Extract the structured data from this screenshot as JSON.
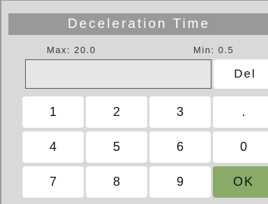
{
  "dialog": {
    "title": "Deceleration Time",
    "max_label": "Max: 20.0",
    "min_label": "Min: 0.5",
    "input_value": ""
  },
  "keypad": {
    "del_label": "Del",
    "keys": {
      "k1": "1",
      "k2": "2",
      "k3": "3",
      "dot": ".",
      "k4": "4",
      "k5": "5",
      "k6": "6",
      "k0": "0",
      "k7": "7",
      "k8": "8",
      "k9": "9",
      "ok": "OK"
    }
  },
  "colors": {
    "title_bar": "#999999",
    "panel": "#d9d9d9",
    "ok_button": "#8aab68"
  }
}
